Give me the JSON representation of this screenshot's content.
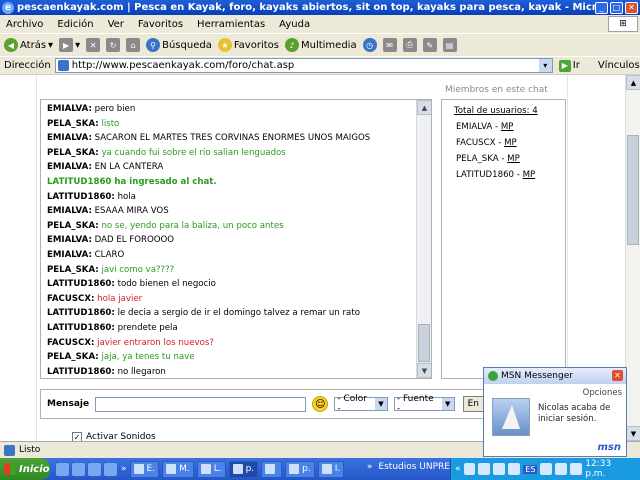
{
  "window": {
    "title": "pescaenkayak.com | Pesca en Kayak, foro, kayaks abiertos, sit on top, kayaks para pesca, kayak  - Microsoft Internet Explorer"
  },
  "menu": [
    "Archivo",
    "Edición",
    "Ver",
    "Favoritos",
    "Herramientas",
    "Ayuda"
  ],
  "toolbar": {
    "back_label": "Atrás",
    "search_label": "Búsqueda",
    "favorites_label": "Favoritos",
    "multimedia_label": "Multimedia"
  },
  "address": {
    "label": "Dirección",
    "url": "http://www.pescaenkayak.com/foro/chat.asp",
    "go_label": "Ir",
    "links_label": "Vínculos"
  },
  "chat": {
    "lines": [
      {
        "nick": "EMIALVA:",
        "text": "pero bien",
        "color": "black"
      },
      {
        "nick": "PELA_SKA:",
        "text": "listo",
        "color": "green"
      },
      {
        "nick": "EMIALVA:",
        "text": "SACARON EL MARTES TRES CORVINAS ENORMES UNOS MAIGOS",
        "color": "black"
      },
      {
        "nick": "PELA_SKA:",
        "text": "ya cuando fui sobre el rio salian lenguados",
        "color": "green"
      },
      {
        "nick": "EMIALVA:",
        "text": "EN LA CANTERA",
        "color": "black"
      },
      {
        "nick": "",
        "text": "LATITUD1860 ha ingresado al chat.",
        "color": "system"
      },
      {
        "nick": "LATITUD1860:",
        "text": "hola",
        "color": "black"
      },
      {
        "nick": "EMIALVA:",
        "text": "ESAAA MIRA VOS",
        "color": "black"
      },
      {
        "nick": "PELA_SKA:",
        "text": "no se, yendo para la baliza, un poco antes",
        "color": "green"
      },
      {
        "nick": "EMIALVA:",
        "text": "DAD EL FOROOOO",
        "color": "black"
      },
      {
        "nick": "EMIALVA:",
        "text": "CLARO",
        "color": "black"
      },
      {
        "nick": "PELA_SKA:",
        "text": "javi como va????",
        "color": "green"
      },
      {
        "nick": "LATITUD1860:",
        "text": "todo bienen el negocio",
        "color": "black"
      },
      {
        "nick": "FACUSCX:",
        "text": "hola javier",
        "color": "red"
      },
      {
        "nick": "LATITUD1860:",
        "text": "le decia a sergio de ir el domingo talvez a remar un rato",
        "color": "black"
      },
      {
        "nick": "LATITUD1860:",
        "text": "prendete pela",
        "color": "black"
      },
      {
        "nick": "FACUSCX:",
        "text": "javier entraron los nuevos?",
        "color": "red"
      },
      {
        "nick": "PELA_SKA:",
        "text": "jaja, ya tenes tu nave",
        "color": "green"
      },
      {
        "nick": "LATITUD1860:",
        "text": "no llegaron",
        "color": "black"
      }
    ]
  },
  "members": {
    "title": "Miembros en este chat",
    "total": "Total de usuarios: 4",
    "list": [
      {
        "name": "EMIALVA",
        "mp": "MP"
      },
      {
        "name": "FACUSCX",
        "mp": "MP"
      },
      {
        "name": "PELA_SKA",
        "mp": "MP"
      },
      {
        "name": "LATITUD1860",
        "mp": "MP"
      }
    ]
  },
  "compose": {
    "label": "Mensaje",
    "color_select": "- Color -",
    "font_select": "- Fuente -",
    "send_label": "En",
    "checkbox_label": "Activar Sonidos"
  },
  "status": {
    "text": "Listo"
  },
  "taskbar": {
    "start_label": "Inicio",
    "tasks": [
      "E.",
      "M.",
      "L.",
      "p.",
      "",
      "p.",
      "I."
    ],
    "tray_label": "Estudios UNPRE",
    "lang": "ES",
    "clock": "12:33 p.m."
  },
  "msn": {
    "title": "MSN Messenger",
    "options": "Opciones",
    "message": "Nicolas acaba de iniciar sesión.",
    "brand": "msn"
  }
}
